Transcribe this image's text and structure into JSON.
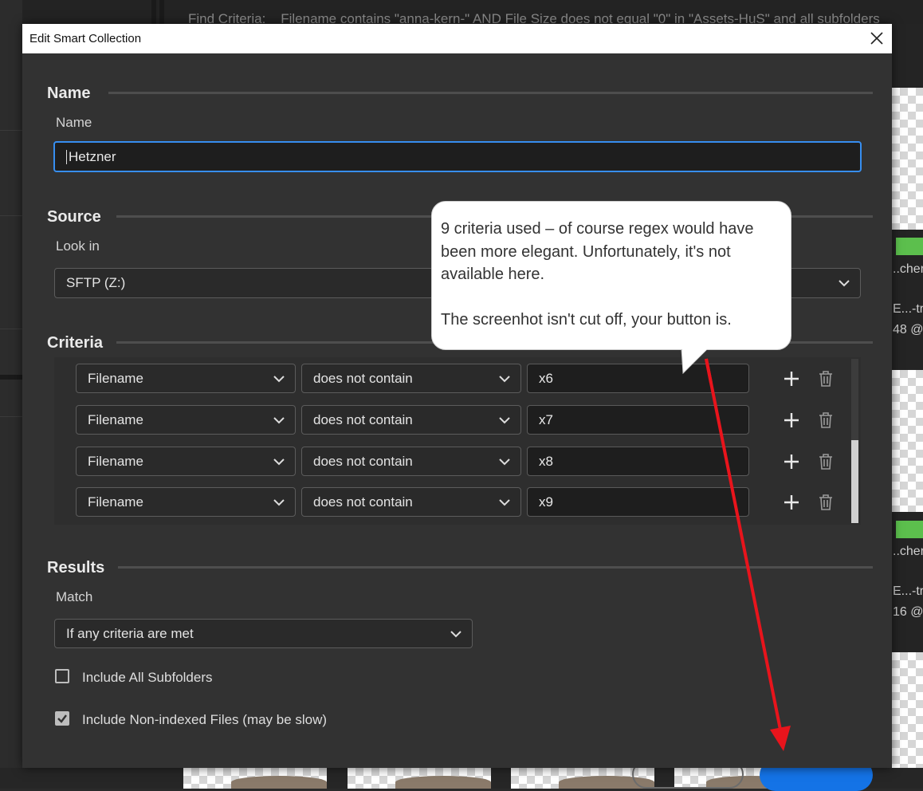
{
  "background": {
    "find_criteria_label": "Find Criteria:",
    "find_criteria_value": "Filename contains \"anna-kern-\" AND File Size does not equal \"0\" in \"Assets-HuS\" and all subfolders",
    "thumb_text_1": "..cher",
    "thumb_text_2": "E...-tra",
    "thumb_text_3": "48 @",
    "thumb_text_4": "..cher",
    "thumb_text_5": "E...-tra",
    "thumb_text_6": "16 @"
  },
  "dialog": {
    "title": "Edit Smart Collection",
    "close_icon": "close-icon",
    "name_section": {
      "title": "Name",
      "field_label": "Name",
      "field_value": "Hetzner"
    },
    "source_section": {
      "title": "Source",
      "look_in_label": "Look in",
      "look_in_value": "SFTP (Z:)"
    },
    "criteria_section": {
      "title": "Criteria",
      "rows": [
        {
          "field": "Filename",
          "operator": "does not contain",
          "value": "x6"
        },
        {
          "field": "Filename",
          "operator": "does not contain",
          "value": "x7"
        },
        {
          "field": "Filename",
          "operator": "does not contain",
          "value": "x8"
        },
        {
          "field": "Filename",
          "operator": "does not contain",
          "value": "x9"
        }
      ],
      "add_icon": "plus-icon",
      "delete_icon": "trash-icon"
    },
    "results_section": {
      "title": "Results",
      "match_label": "Match",
      "match_value": "If any criteria are met",
      "include_subfolders_label": "Include All Subfolders",
      "include_subfolders_checked": false,
      "include_nonindexed_label": "Include Non-indexed Files (may be slow)",
      "include_nonindexed_checked": true
    }
  },
  "annotation": {
    "callout_line1": "9 criteria used – of course regex would have been more elegant. Unfortunately, it's not available here.",
    "callout_line2": "The screenhot isn't cut off, your button is.",
    "arrow_color": "#e8141c"
  },
  "colors": {
    "accent": "#378ef0",
    "button_blue": "#1473e6",
    "dialog_bg": "#323232"
  }
}
